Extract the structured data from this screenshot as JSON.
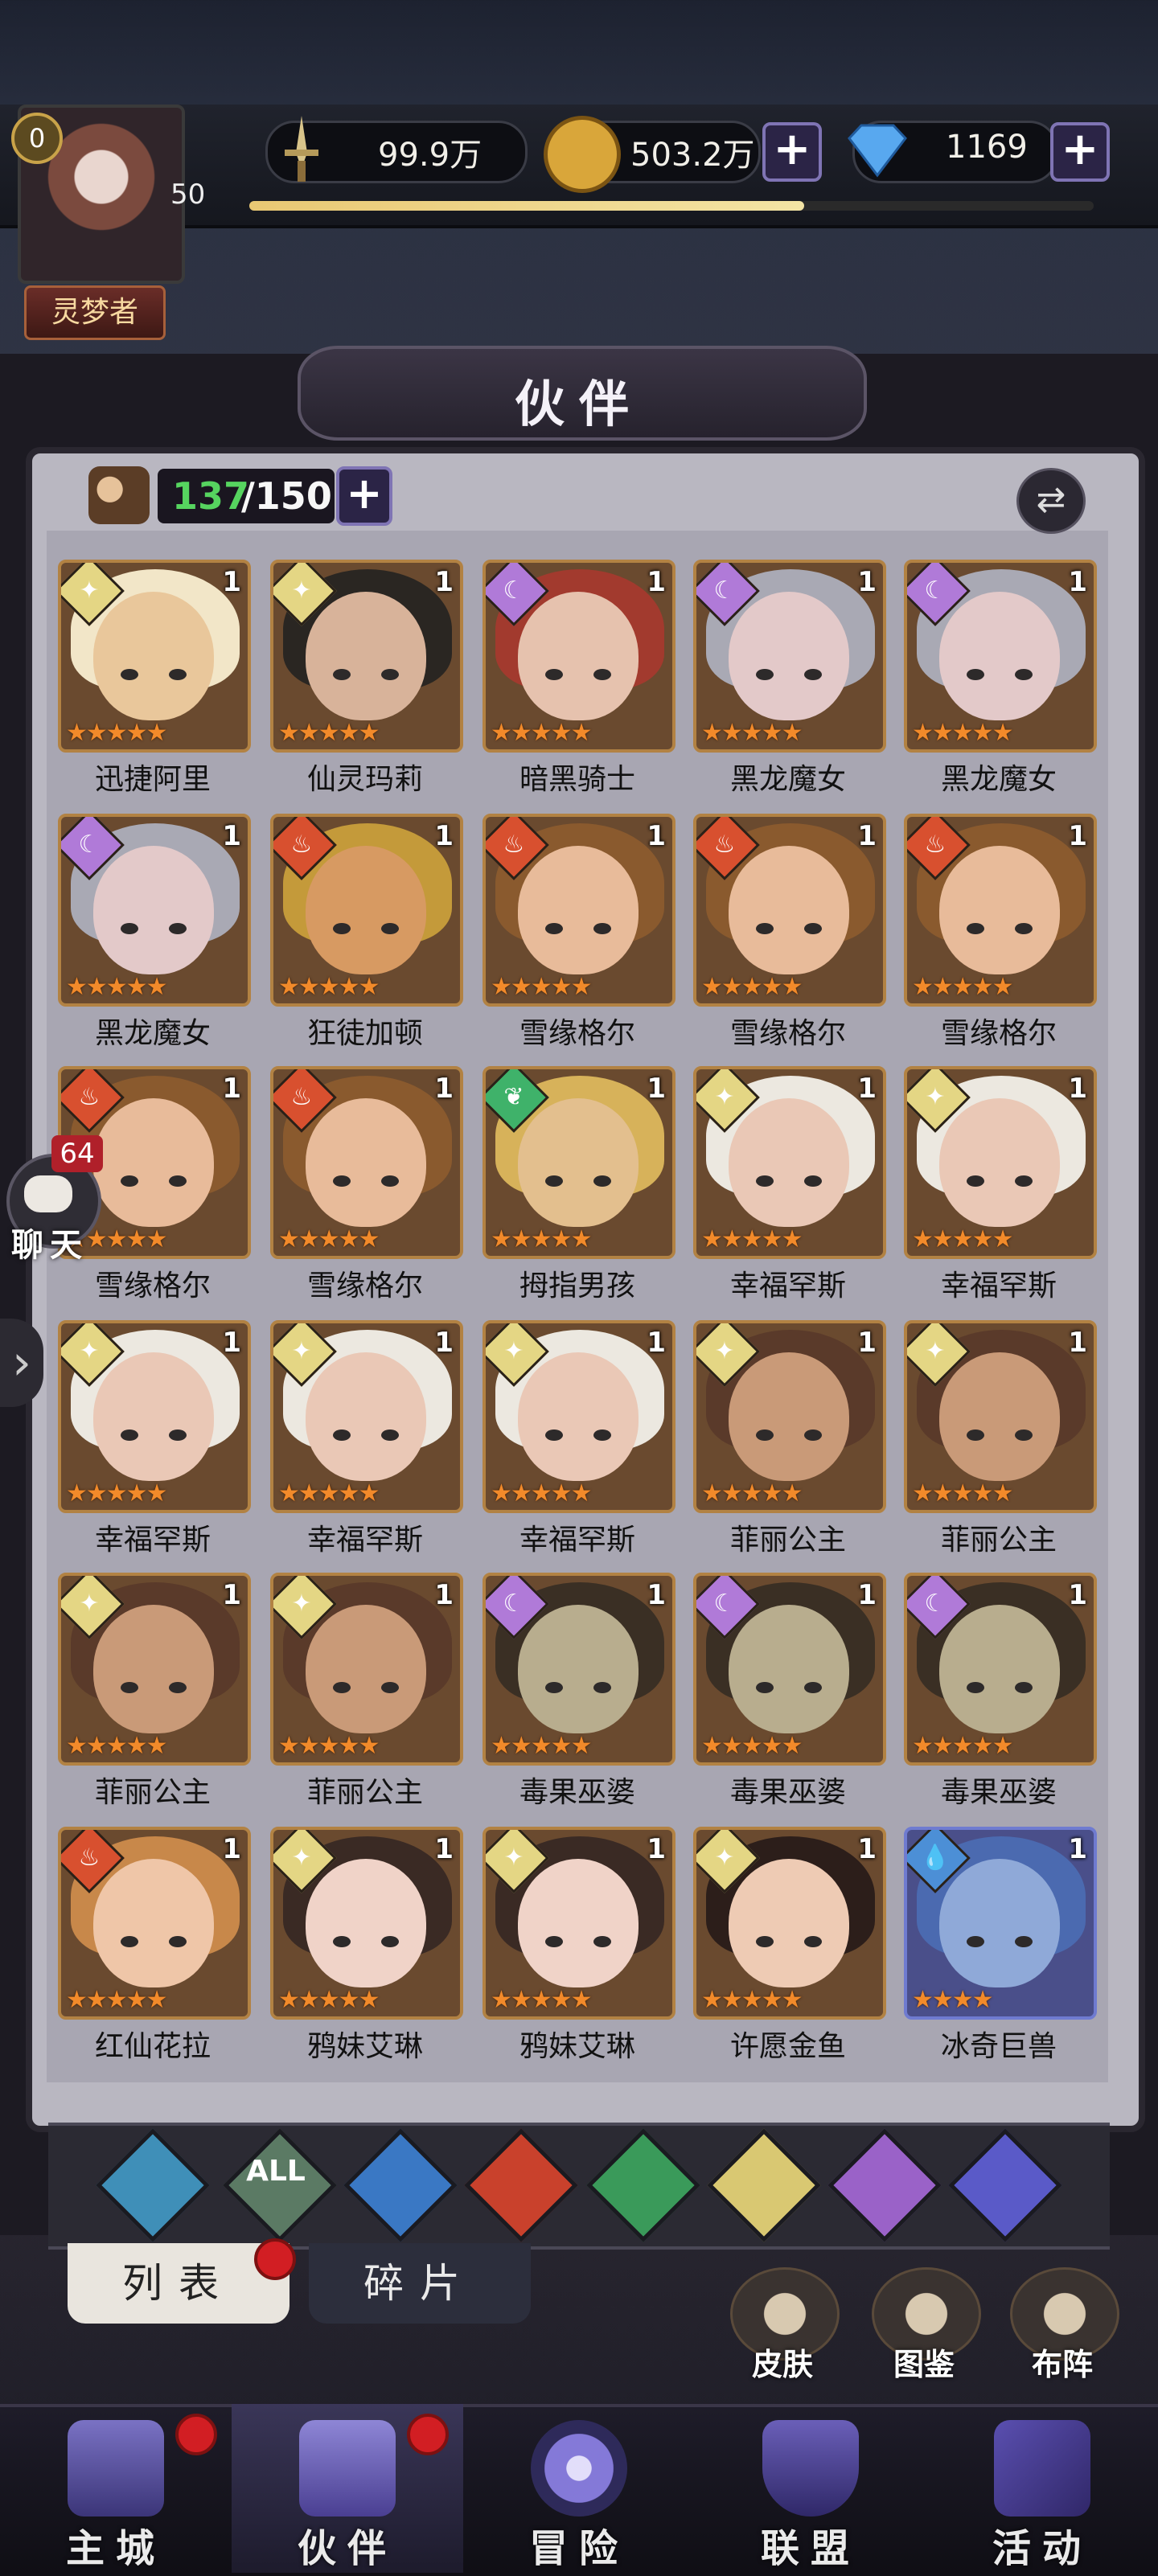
{
  "player": {
    "vip": "0",
    "level": "50",
    "title": "灵梦者"
  },
  "resources": {
    "power": "99.9万",
    "gold": "503.2万",
    "gems": "1169"
  },
  "panel": {
    "title": "伙伴"
  },
  "roster": {
    "current": "137",
    "max": "/150"
  },
  "heroes": [
    {
      "name": "迅捷阿里",
      "element": "light",
      "level": "1",
      "stars": "★★★★★"
    },
    {
      "name": "仙灵玛莉",
      "element": "light",
      "level": "1",
      "stars": "★★★★★"
    },
    {
      "name": "暗黑骑士",
      "element": "dark",
      "level": "1",
      "stars": "★★★★★"
    },
    {
      "name": "黑龙魔女",
      "element": "dark",
      "level": "1",
      "stars": "★★★★★"
    },
    {
      "name": "黑龙魔女",
      "element": "dark",
      "level": "1",
      "stars": "★★★★★"
    },
    {
      "name": "黑龙魔女",
      "element": "dark",
      "level": "1",
      "stars": "★★★★★"
    },
    {
      "name": "狂徒加顿",
      "element": "fire",
      "level": "1",
      "stars": "★★★★★"
    },
    {
      "name": "雪缘格尔",
      "element": "fire",
      "level": "1",
      "stars": "★★★★★"
    },
    {
      "name": "雪缘格尔",
      "element": "fire",
      "level": "1",
      "stars": "★★★★★"
    },
    {
      "name": "雪缘格尔",
      "element": "fire",
      "level": "1",
      "stars": "★★★★★"
    },
    {
      "name": "雪缘格尔",
      "element": "fire",
      "level": "1",
      "stars": "★★★★★"
    },
    {
      "name": "雪缘格尔",
      "element": "fire",
      "level": "1",
      "stars": "★★★★★"
    },
    {
      "name": "拇指男孩",
      "element": "nature",
      "level": "1",
      "stars": "★★★★★"
    },
    {
      "name": "幸福罕斯",
      "element": "light",
      "level": "1",
      "stars": "★★★★★"
    },
    {
      "name": "幸福罕斯",
      "element": "light",
      "level": "1",
      "stars": "★★★★★"
    },
    {
      "name": "幸福罕斯",
      "element": "light",
      "level": "1",
      "stars": "★★★★★"
    },
    {
      "name": "幸福罕斯",
      "element": "light",
      "level": "1",
      "stars": "★★★★★"
    },
    {
      "name": "幸福罕斯",
      "element": "light",
      "level": "1",
      "stars": "★★★★★"
    },
    {
      "name": "菲丽公主",
      "element": "light",
      "level": "1",
      "stars": "★★★★★"
    },
    {
      "name": "菲丽公主",
      "element": "light",
      "level": "1",
      "stars": "★★★★★"
    },
    {
      "name": "菲丽公主",
      "element": "light",
      "level": "1",
      "stars": "★★★★★"
    },
    {
      "name": "菲丽公主",
      "element": "light",
      "level": "1",
      "stars": "★★★★★"
    },
    {
      "name": "毒果巫婆",
      "element": "dark",
      "level": "1",
      "stars": "★★★★★"
    },
    {
      "name": "毒果巫婆",
      "element": "dark",
      "level": "1",
      "stars": "★★★★★"
    },
    {
      "name": "毒果巫婆",
      "element": "dark",
      "level": "1",
      "stars": "★★★★★"
    },
    {
      "name": "红仙花拉",
      "element": "fire",
      "level": "1",
      "stars": "★★★★★"
    },
    {
      "name": "鸦妹艾琳",
      "element": "light",
      "level": "1",
      "stars": "★★★★★"
    },
    {
      "name": "鸦妹艾琳",
      "element": "light",
      "level": "1",
      "stars": "★★★★★"
    },
    {
      "name": "许愿金鱼",
      "element": "light",
      "level": "1",
      "stars": "★★★★★"
    },
    {
      "name": "冰奇巨兽",
      "element": "water",
      "level": "1",
      "stars": "★★★★"
    }
  ],
  "filters": [
    {
      "name": "filter-all-elements-icon",
      "label": "",
      "color": "#3f8fb8"
    },
    {
      "name": "filter-all-icon",
      "label": "ALL",
      "color": "#5b7a64"
    },
    {
      "name": "filter-water-icon",
      "label": "",
      "color": "#3a78c4"
    },
    {
      "name": "filter-fire-icon",
      "label": "",
      "color": "#c9412c"
    },
    {
      "name": "filter-nature-icon",
      "label": "",
      "color": "#3a9a5a"
    },
    {
      "name": "filter-light-icon",
      "label": "",
      "color": "#d9c872"
    },
    {
      "name": "filter-dark-icon",
      "label": "",
      "color": "#9a62c8"
    },
    {
      "name": "filter-cosmic-icon",
      "label": "",
      "color": "#5a5ac8"
    }
  ],
  "tabs": {
    "list": "列表",
    "fragments": "碎片"
  },
  "side_buttons": {
    "skin": "皮肤",
    "codex": "图鉴",
    "formation": "布阵"
  },
  "chat": {
    "badge": "64",
    "label": "聊天"
  },
  "nav": {
    "city": "主城",
    "partner": "伙伴",
    "adventure": "冒险",
    "alliance": "联盟",
    "event": "活动"
  },
  "colors": {
    "accent": "#7f74b4",
    "progress": "#e9c873",
    "badge_red": "#d21e23",
    "count_green": "#56d45f"
  }
}
